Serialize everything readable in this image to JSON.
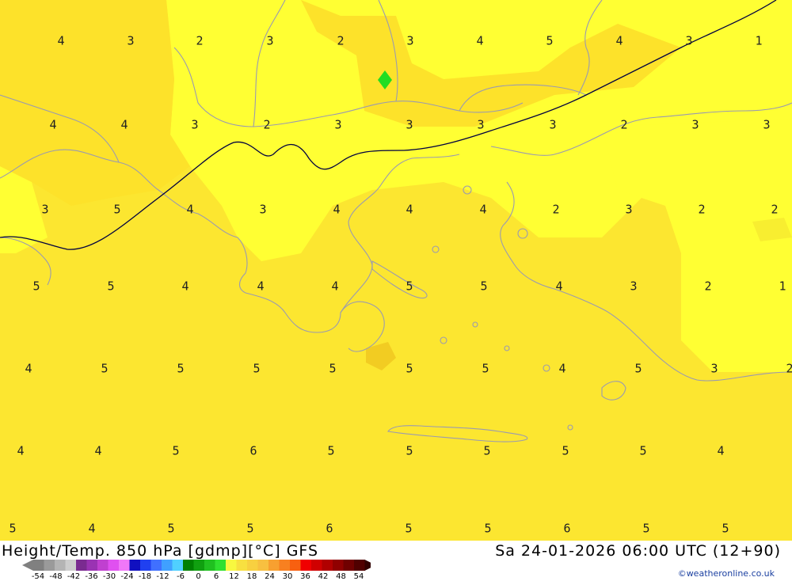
{
  "title": "Height/Temp. 850 hPa [gdmp][°C] GFS",
  "datetime": "Sa 24-01-2026 06:00 UTC (12+90)",
  "credit": "©weatheronline.co.uk",
  "colors": {
    "base_fill": "#fce630",
    "zone_fill": "#ffff33",
    "warm_patch": "#f2cc22",
    "coastline": "#9a9ab0",
    "contour": "#000040",
    "marker": "#22dd22"
  },
  "grid_values": [
    [
      "4",
      "3",
      "2",
      "3",
      "2",
      "3",
      "4",
      "5",
      "4",
      "3",
      "1"
    ],
    [
      "4",
      "4",
      "3",
      "2",
      "3",
      "3",
      "3",
      "3",
      "2",
      "3",
      "3"
    ],
    [
      "3",
      "5",
      "4",
      "3",
      "4",
      "4",
      "4",
      "2",
      "3",
      "2",
      "2"
    ],
    [
      "5",
      "5",
      "4",
      "4",
      "4",
      "5",
      "5",
      "4",
      "3",
      "2",
      "1"
    ],
    [
      "4",
      "5",
      "5",
      "5",
      "5",
      "5",
      "5",
      "4",
      "5",
      "3",
      "2"
    ],
    [
      "4",
      "4",
      "5",
      "6",
      "5",
      "5",
      "5",
      "5",
      "5",
      "4"
    ],
    [
      "5",
      "4",
      "5",
      "5",
      "6",
      "5",
      "5",
      "6",
      "5",
      "5"
    ]
  ],
  "scale": {
    "colors": [
      "#808080",
      "#9a9a9a",
      "#b4b4b4",
      "#cdcdcd",
      "#7a2b90",
      "#9a33b3",
      "#c040d0",
      "#e050f0",
      "#f078f8",
      "#1010c0",
      "#2040f0",
      "#4070ff",
      "#40a0ff",
      "#50d0ff",
      "#008000",
      "#10a010",
      "#20c020",
      "#30e030",
      "#f8f840",
      "#f8e040",
      "#f8d040",
      "#f8c040",
      "#f8a030",
      "#f88020",
      "#f86010",
      "#f00000",
      "#d00000",
      "#b00000",
      "#900000",
      "#700000",
      "#500000"
    ],
    "tick_labels": [
      "-54",
      "-48",
      "-42",
      "-36",
      "-30",
      "-24",
      "-18",
      "-12",
      "-6",
      "0",
      "6",
      "12",
      "18",
      "24",
      "30",
      "36",
      "42",
      "48",
      "54"
    ]
  }
}
